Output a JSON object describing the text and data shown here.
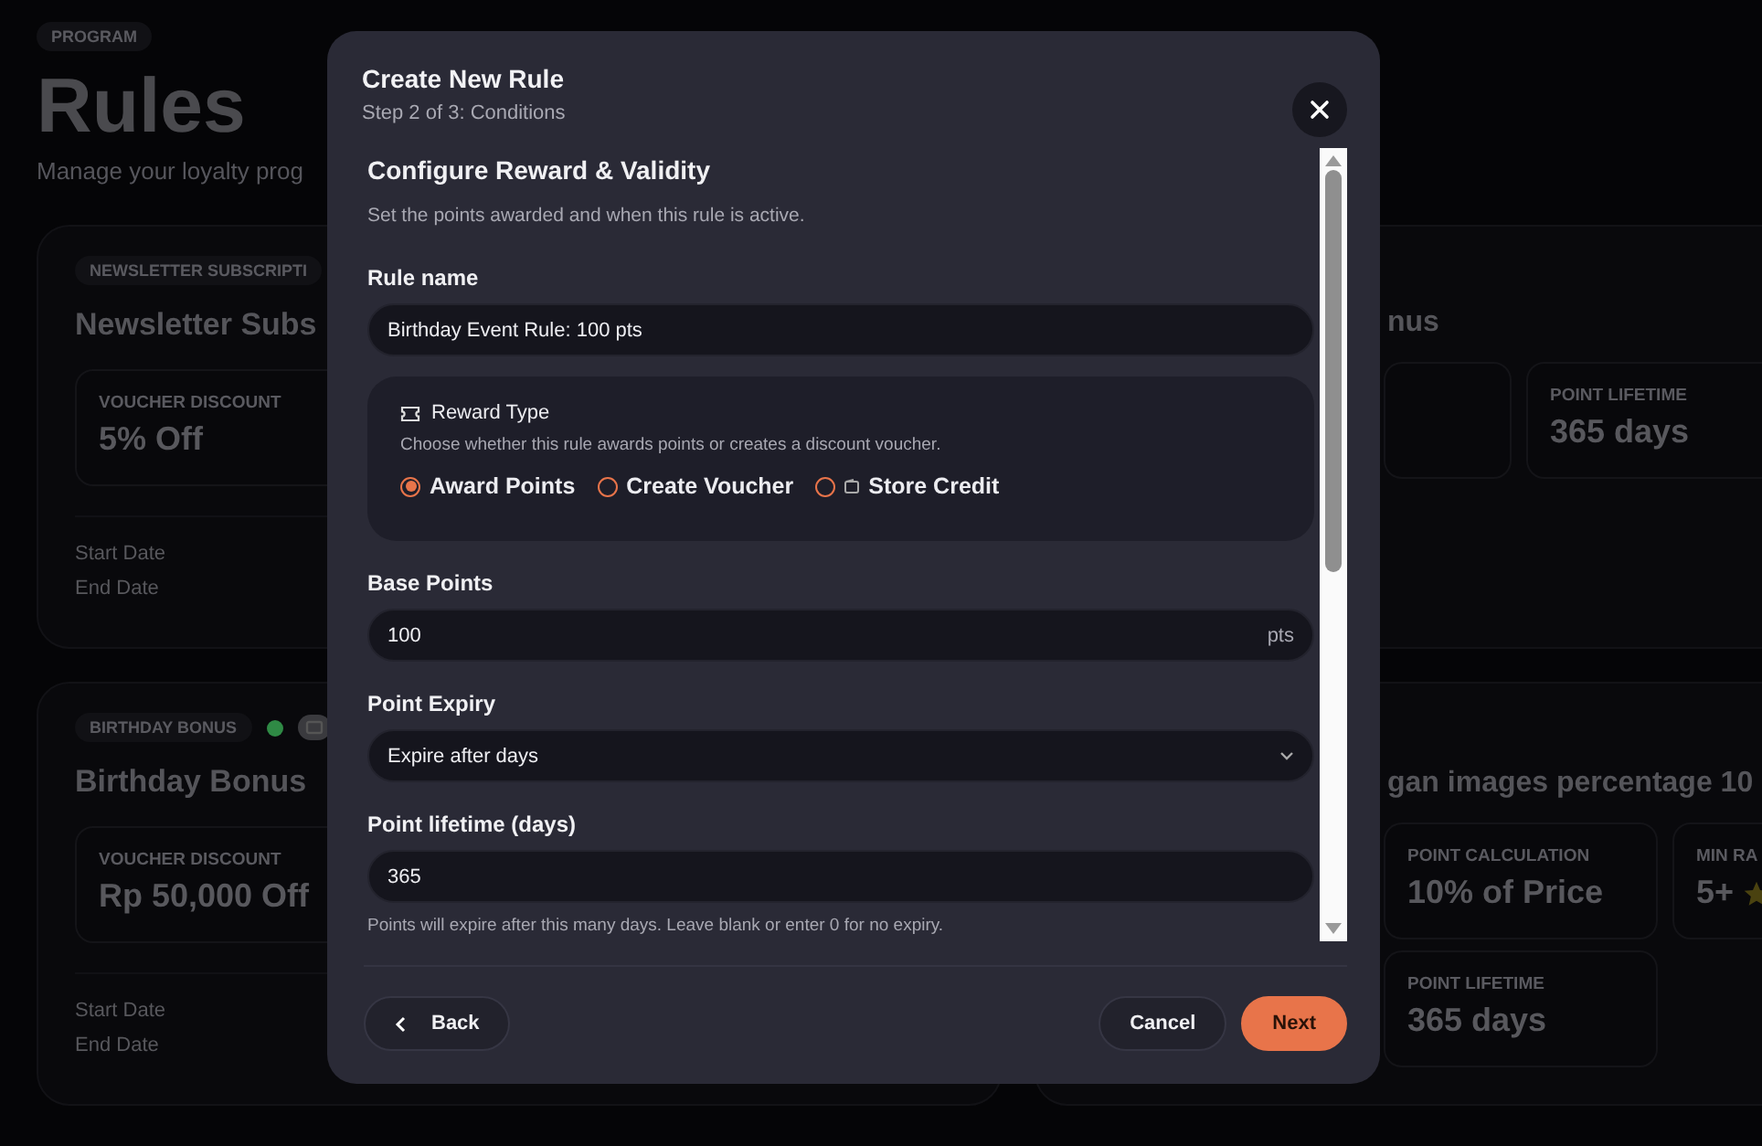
{
  "background": {
    "badge": "PROGRAM",
    "title": "Rules",
    "subtitle": "Manage your loyalty prog",
    "rows": [
      {
        "left": {
          "badge": "NEWSLETTER SUBSCRIPTI",
          "active": false,
          "title": "Newsletter Subs",
          "stats": [
            {
              "label": "VOUCHER DISCOUNT",
              "value": "5% Off"
            }
          ],
          "dates": [
            "Start Date",
            "End Date"
          ]
        },
        "right": {
          "title": "nus",
          "stats": [
            {
              "kind": "blank"
            },
            {
              "kind": "stat",
              "label": "POINT LIFETIME",
              "value": "365 days"
            }
          ]
        }
      },
      {
        "left": {
          "badge": "BIRTHDAY BONUS",
          "active": true,
          "title": "Birthday Bonus",
          "stats": [
            {
              "label": "VOUCHER DISCOUNT",
              "value": "Rp 50,000 Off"
            }
          ],
          "dates": [
            "Start Date",
            "End Date"
          ]
        },
        "right": {
          "title": "gan images percentage 10",
          "stats": [
            {
              "label": "POINT CALCULATION",
              "value": "10% of Price"
            },
            {
              "label": "MIN RA",
              "value": "5+",
              "star": true
            },
            {
              "label": "POINT LIFETIME",
              "value": "365 days"
            }
          ]
        }
      }
    ]
  },
  "modal": {
    "title": "Create New Rule",
    "subtitle": "Step 2 of 3: Conditions",
    "section_title": "Configure Reward & Validity",
    "section_description": "Set the points awarded and when this rule is active.",
    "fields": [
      {
        "kind": "text",
        "label": "Rule name",
        "value": "Birthday Event Rule: 100 pts"
      },
      {
        "kind": "radio_group",
        "label": "Reward Type",
        "description": "Choose whether this rule awards points or creates a discount voucher.",
        "options": [
          {
            "label": "Award Points",
            "selected": true,
            "kind": "plain"
          },
          {
            "label": "Create Voucher",
            "selected": false,
            "kind": "plain"
          },
          {
            "label": "Store Credit",
            "selected": false,
            "kind": "with_icon"
          }
        ]
      },
      {
        "kind": "number",
        "label": "Base Points",
        "value": "100",
        "suffix": "pts"
      },
      {
        "kind": "select",
        "label": "Point Expiry",
        "value": "Expire after days"
      },
      {
        "kind": "text",
        "label": "Point lifetime (days)",
        "value": "365",
        "hint": "Points will expire after this many days. Leave blank or enter 0 for no expiry."
      }
    ],
    "back": "Back",
    "cancel": "Cancel",
    "next": "Next"
  }
}
